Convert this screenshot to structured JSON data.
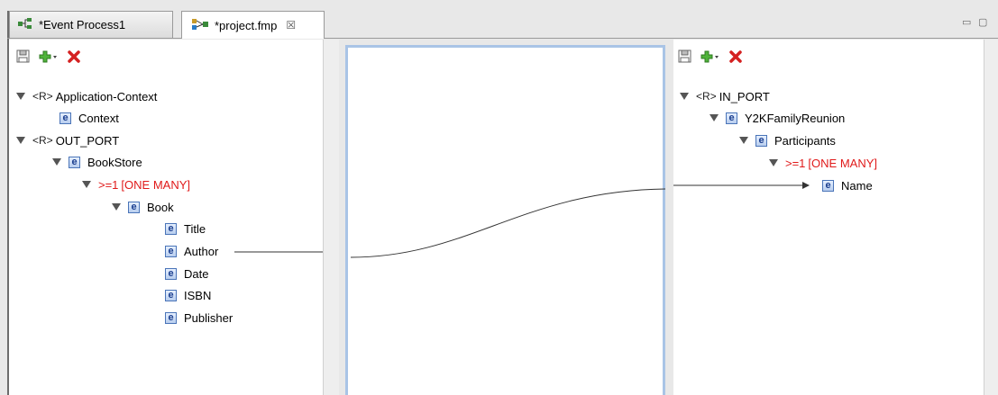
{
  "tabs": [
    {
      "label": "*Event Process1"
    },
    {
      "label": "*project.fmp",
      "close": "☒"
    }
  ],
  "window_controls": {
    "minimize": "▭",
    "maximize": "▢"
  },
  "left_tree": {
    "rows": [
      {
        "tag": "<R>",
        "label": "Application-Context"
      },
      {
        "label": "Context"
      },
      {
        "tag": "<R>",
        "label": "OUT_PORT"
      },
      {
        "label": "BookStore"
      },
      {
        "card": ">=1",
        "label": "[ONE MANY]"
      },
      {
        "label": "Book"
      },
      {
        "label": "Title"
      },
      {
        "label": "Author"
      },
      {
        "label": "Date"
      },
      {
        "label": "ISBN"
      },
      {
        "label": "Publisher"
      }
    ]
  },
  "right_tree": {
    "rows": [
      {
        "tag": "<R>",
        "label": "IN_PORT"
      },
      {
        "label": "Y2KFamilyReunion"
      },
      {
        "label": "Participants"
      },
      {
        "card": ">=1",
        "label": "[ONE MANY]"
      },
      {
        "label": "Name"
      }
    ]
  },
  "element_icon_letter": "e",
  "colors": {
    "cardinality": "#e01a1a",
    "mid_border": "#a9c4e6"
  }
}
